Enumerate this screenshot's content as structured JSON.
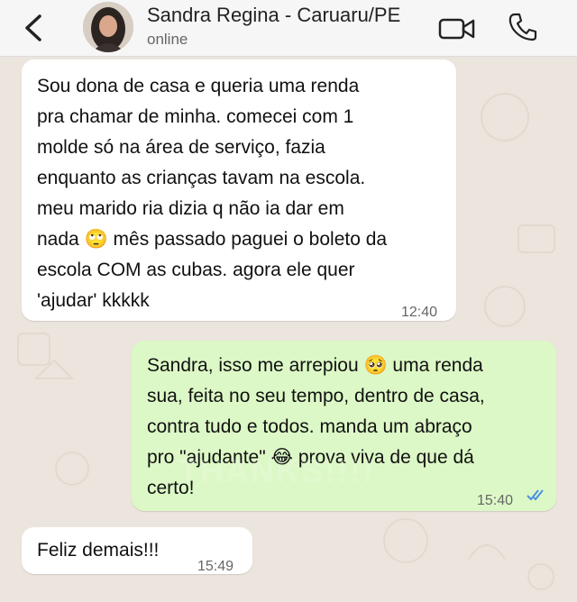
{
  "header": {
    "contact_name": "Sandra Regina - Caruaru/PE",
    "status": "online"
  },
  "messages": [
    {
      "text": "Sou dona de casa e queria uma renda\npra chamar de minha. comecei com 1\nmolde só na área de serviço, fazia\nenquanto as crianças tavam na escola.\nmeu marido ria dizia q não ia dar em\nnada 🙄 mês passado paguei o boleto da\nescola COM as cubas. agora ele quer\n'ajudar' kkkkk",
      "time": "12:40"
    },
    {
      "text": "Sandra, isso me arrepiou 🥺 uma renda\nsua, feita no seu tempo, dentro de casa,\ncontra tudo e todos. manda um abraço\npro \"ajudante\" 😂 prova viva de que dá\ncerto!",
      "time": "15:40"
    },
    {
      "text": "Feliz demais!!!",
      "time": "15:49"
    }
  ],
  "watermark": "THANKS!!!!",
  "colors": {
    "incoming_bubble": "#ffffff",
    "outgoing_bubble": "#dcf8c6",
    "read_ticks": "#4a90e2",
    "chat_background": "#ece5dd"
  }
}
